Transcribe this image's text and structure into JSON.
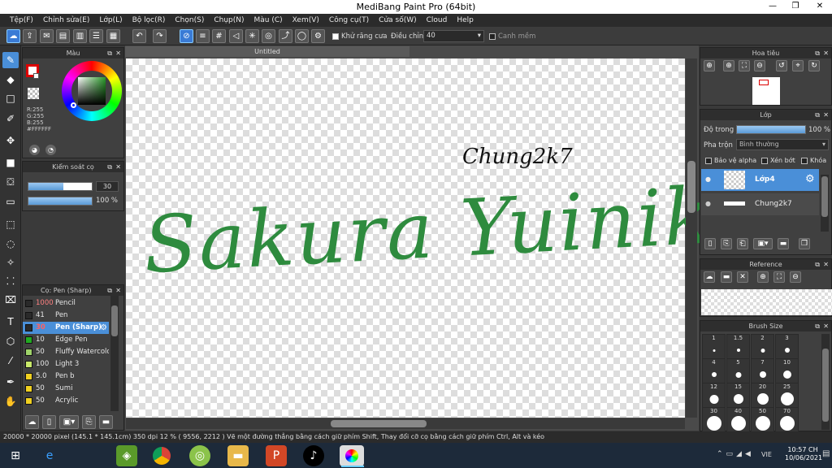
{
  "window": {
    "title": "MediBang Paint Pro (64bit)",
    "min": "—",
    "max": "❐",
    "close": "✕"
  },
  "menu": [
    "Tệp(F)",
    "Chỉnh sửa(E)",
    "Lớp(L)",
    "Bộ lọc(R)",
    "Chọn(S)",
    "Chụp(N)",
    "Màu (C)",
    "Xem(V)",
    "Công cụ(T)",
    "Cửa số(W)",
    "Cloud",
    "Help"
  ],
  "toolbar": {
    "antialias_label": "Khử răng cưa",
    "correction_label": "Điều chỉnh",
    "correction_value": "40",
    "edge_label": "Canh mềm"
  },
  "color_panel": {
    "title": "Màu",
    "r": "R:255",
    "g": "G:255",
    "b": "B:255",
    "hex": "#FFFFFF"
  },
  "brush_control": {
    "title": "Kiểm soát cọ",
    "size": "30",
    "opacity": "100 %"
  },
  "brush_list": {
    "title": "Cọ: Pen (Sharp)",
    "items": [
      {
        "size": "1000",
        "name": "Pencil",
        "color": "#2a2a2a"
      },
      {
        "size": "41",
        "name": "Pen",
        "color": "#2a2a2a"
      },
      {
        "size": "30",
        "name": "Pen (Sharp)",
        "color": "#2a2a2a"
      },
      {
        "size": "10",
        "name": "Edge Pen",
        "color": "#22aa22"
      },
      {
        "size": "50",
        "name": "Fluffy Watercolo",
        "color": "#9fd36a"
      },
      {
        "size": "100",
        "name": "Light 3",
        "color": "#c8e86a"
      },
      {
        "size": "5.0",
        "name": "Pen b",
        "color": "#f0d020"
      },
      {
        "size": "50",
        "name": "Sumi",
        "color": "#f0d020"
      },
      {
        "size": "50",
        "name": "Acrylic",
        "color": "#f0d020"
      }
    ]
  },
  "canvas": {
    "tab": "Untitled",
    "signature": "Chung2k7",
    "main_text": "Sakura Yuiniko",
    "ink": "#2e8b3e"
  },
  "navigator": {
    "title": "Hoa tiêu"
  },
  "layers": {
    "title": "Lớp",
    "opacity_label": "Độ trong",
    "opacity_value": "100 %",
    "blend_label": "Pha trộn",
    "blend_value": "Bình thường",
    "protect_alpha": "Bảo vệ alpha",
    "clipping": "Xén bớt",
    "lock": "Khóa",
    "items": [
      {
        "name": "Lớp4",
        "selected": true
      },
      {
        "name": "Chung2k7",
        "selected": false
      }
    ]
  },
  "reference": {
    "title": "Reference"
  },
  "brush_size": {
    "title": "Brush Size",
    "sizes": [
      "1",
      "1.5",
      "2",
      "3",
      "4",
      "5",
      "7",
      "10",
      "12",
      "15",
      "20",
      "25",
      "30",
      "40",
      "50",
      "70"
    ]
  },
  "status": "20000 * 20000 pixel   (145.1 * 145.1cm)   350 dpi   12 %   ( 9556, 2212 )   Vẽ một đường thẳng bằng cách giữ phím Shift, Thay đổi cỡ cọ bằng cách giữ phím Ctrl, Alt và kéo",
  "taskbar": {
    "lang": "VIE",
    "time": "10:57 CH",
    "date": "10/06/2021"
  }
}
